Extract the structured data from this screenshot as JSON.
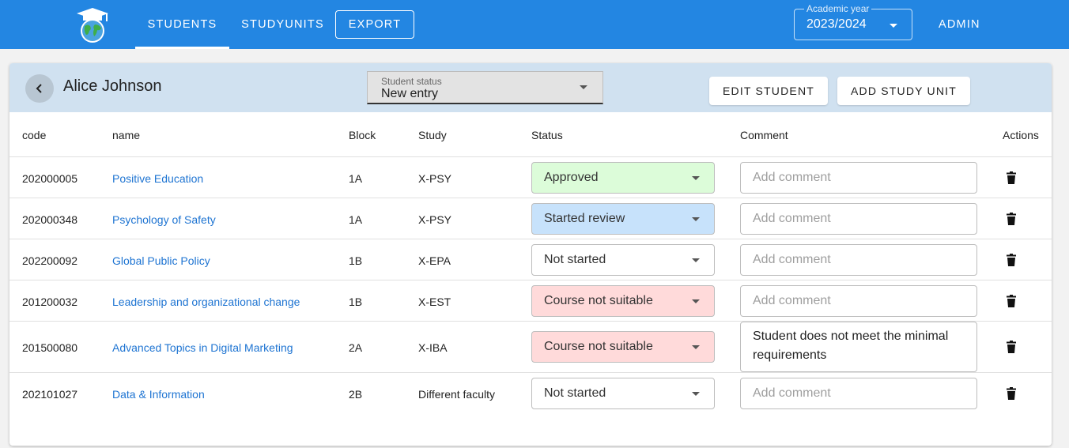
{
  "nav": {
    "tabs": [
      "STUDENTS",
      "STUDYUNITS"
    ],
    "export_label": "EXPORT",
    "academic_year_label": "Academic year",
    "academic_year_value": "2023/2024",
    "user_label": "ADMIN"
  },
  "header": {
    "student_name": "Alice Johnson",
    "student_status_label": "Student status",
    "student_status_value": "New entry",
    "edit_button": "EDIT STUDENT",
    "add_button": "ADD STUDY UNIT"
  },
  "table": {
    "columns": [
      "code",
      "name",
      "Block",
      "Study",
      "Status",
      "Comment",
      "Actions"
    ],
    "comment_placeholder": "Add comment",
    "rows": [
      {
        "code": "202000005",
        "name": "Positive Education",
        "block": "1A",
        "study": "X-PSY",
        "status": "Approved",
        "status_color": "#dcfcd9",
        "comment": ""
      },
      {
        "code": "202000348",
        "name": "Psychology of Safety",
        "block": "1A",
        "study": "X-PSY",
        "status": "Started review",
        "status_color": "#c7e2fb",
        "comment": ""
      },
      {
        "code": "202200092",
        "name": "Global Public Policy",
        "block": "1B",
        "study": "X-EPA",
        "status": "Not started",
        "status_color": "#ffffff",
        "comment": ""
      },
      {
        "code": "201200032",
        "name": "Leadership and organizational change",
        "block": "1B",
        "study": "X-EST",
        "status": "Course not suitable",
        "status_color": "#ffdada",
        "comment": ""
      },
      {
        "code": "201500080",
        "name": "Advanced Topics in Digital Marketing",
        "block": "2A",
        "study": "X-IBA",
        "status": "Course not suitable",
        "status_color": "#ffdada",
        "comment": "Student does not meet the minimal requirements"
      },
      {
        "code": "202101027",
        "name": "Data & Information",
        "block": "2B",
        "study": "Different faculty",
        "status": "Not started",
        "status_color": "#ffffff",
        "comment": ""
      }
    ]
  },
  "icons": {
    "logo": "graduation-globe-logo",
    "back": "chevron-left-icon",
    "dropdown": "caret-down-icon",
    "delete": "trash-icon"
  },
  "colors": {
    "appbar": "#2386e2",
    "card_header": "#d0e1f0",
    "link": "#1e74d2"
  }
}
